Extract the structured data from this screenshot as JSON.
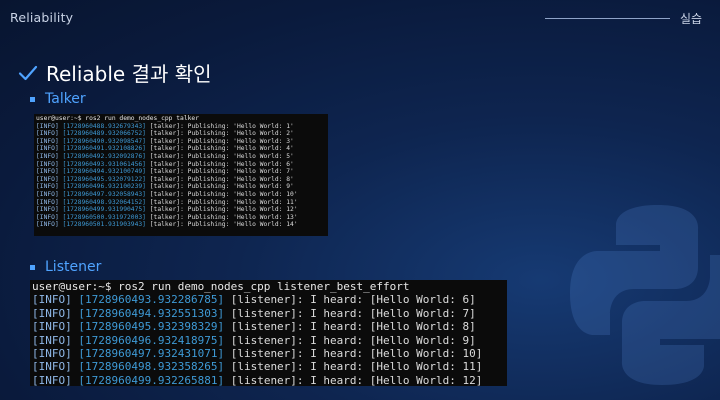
{
  "header": {
    "left_title": "Reliability",
    "right_title": "실습"
  },
  "title": {
    "text": "Reliable 결과 확인",
    "icon": "check-icon"
  },
  "talker": {
    "label": "Talker",
    "prompt": "user@user:~$ ros2 run demo_nodes_cpp talker",
    "lines": [
      {
        "level": "[INFO]",
        "ts": "[1728960488.932679343]",
        "node": "[talker]:",
        "msg": "Publishing: 'Hello World: 1'"
      },
      {
        "level": "[INFO]",
        "ts": "[1728960489.932066752]",
        "node": "[talker]:",
        "msg": "Publishing: 'Hello World: 2'"
      },
      {
        "level": "[INFO]",
        "ts": "[1728960490.932098547]",
        "node": "[talker]:",
        "msg": "Publishing: 'Hello World: 3'"
      },
      {
        "level": "[INFO]",
        "ts": "[1728960491.932108826]",
        "node": "[talker]:",
        "msg": "Publishing: 'Hello World: 4'"
      },
      {
        "level": "[INFO]",
        "ts": "[1728960492.932092876]",
        "node": "[talker]:",
        "msg": "Publishing: 'Hello World: 5'"
      },
      {
        "level": "[INFO]",
        "ts": "[1728960493.931061456]",
        "node": "[talker]:",
        "msg": "Publishing: 'Hello World: 6'"
      },
      {
        "level": "[INFO]",
        "ts": "[1728960494.932100749]",
        "node": "[talker]:",
        "msg": "Publishing: 'Hello World: 7'"
      },
      {
        "level": "[INFO]",
        "ts": "[1728960495.932079122]",
        "node": "[talker]:",
        "msg": "Publishing: 'Hello World: 8'"
      },
      {
        "level": "[INFO]",
        "ts": "[1728960496.932100239]",
        "node": "[talker]:",
        "msg": "Publishing: 'Hello World: 9'"
      },
      {
        "level": "[INFO]",
        "ts": "[1728960497.932058943]",
        "node": "[talker]:",
        "msg": "Publishing: 'Hello World: 10'"
      },
      {
        "level": "[INFO]",
        "ts": "[1728960498.932064152]",
        "node": "[talker]:",
        "msg": "Publishing: 'Hello World: 11'"
      },
      {
        "level": "[INFO]",
        "ts": "[1728960499.931990475]",
        "node": "[talker]:",
        "msg": "Publishing: 'Hello World: 12'"
      },
      {
        "level": "[INFO]",
        "ts": "[1728960500.931972003]",
        "node": "[talker]:",
        "msg": "Publishing: 'Hello World: 13'"
      },
      {
        "level": "[INFO]",
        "ts": "[1728960501.931903943]",
        "node": "[talker]:",
        "msg": "Publishing: 'Hello World: 14'"
      }
    ]
  },
  "listener": {
    "label": "Listener",
    "prompt": "user@user:~$ ros2 run demo_nodes_cpp listener_best_effort",
    "lines": [
      {
        "level": "[INFO]",
        "ts": "[1728960493.932286785]",
        "node": "[listener]:",
        "msg": "I heard: [Hello World: 6]"
      },
      {
        "level": "[INFO]",
        "ts": "[1728960494.932551303]",
        "node": "[listener]:",
        "msg": "I heard: [Hello World: 7]"
      },
      {
        "level": "[INFO]",
        "ts": "[1728960495.932398329]",
        "node": "[listener]:",
        "msg": "I heard: [Hello World: 8]"
      },
      {
        "level": "[INFO]",
        "ts": "[1728960496.932418975]",
        "node": "[listener]:",
        "msg": "I heard: [Hello World: 9]"
      },
      {
        "level": "[INFO]",
        "ts": "[1728960497.932431071]",
        "node": "[listener]:",
        "msg": "I heard: [Hello World: 10]"
      },
      {
        "level": "[INFO]",
        "ts": "[1728960498.932358265]",
        "node": "[listener]:",
        "msg": "I heard: [Hello World: 11]"
      },
      {
        "level": "[INFO]",
        "ts": "[1728960499.932265881]",
        "node": "[listener]:",
        "msg": "I heard: [Hello World: 12]"
      }
    ]
  },
  "colors": {
    "accent": "#4fa3ff",
    "timestamp": "#3e9ad6",
    "terminal_bg": "#0b0b0b"
  }
}
